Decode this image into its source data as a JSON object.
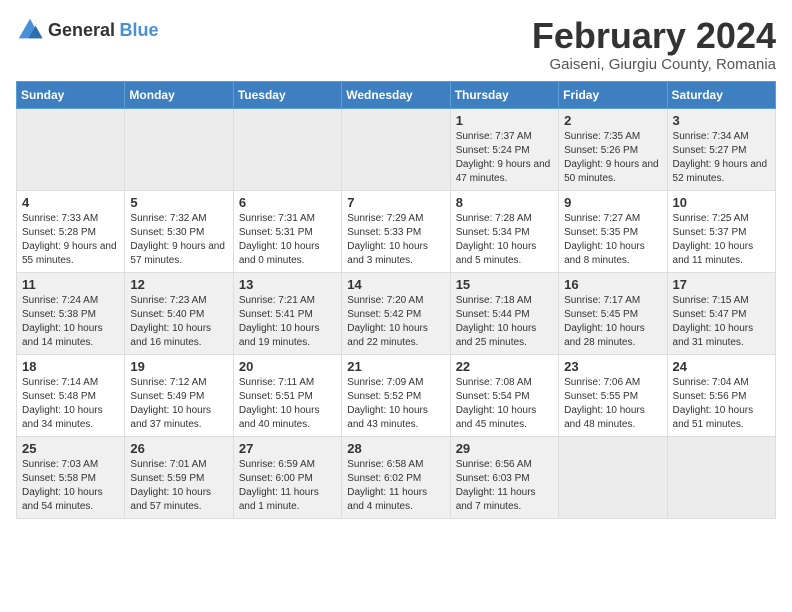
{
  "logo": {
    "general": "General",
    "blue": "Blue"
  },
  "header": {
    "month_year": "February 2024",
    "location": "Gaiseni, Giurgiu County, Romania"
  },
  "weekdays": [
    "Sunday",
    "Monday",
    "Tuesday",
    "Wednesday",
    "Thursday",
    "Friday",
    "Saturday"
  ],
  "weeks": [
    [
      {
        "day": "",
        "info": ""
      },
      {
        "day": "",
        "info": ""
      },
      {
        "day": "",
        "info": ""
      },
      {
        "day": "",
        "info": ""
      },
      {
        "day": "1",
        "info": "Sunrise: 7:37 AM\nSunset: 5:24 PM\nDaylight: 9 hours\nand 47 minutes."
      },
      {
        "day": "2",
        "info": "Sunrise: 7:35 AM\nSunset: 5:26 PM\nDaylight: 9 hours\nand 50 minutes."
      },
      {
        "day": "3",
        "info": "Sunrise: 7:34 AM\nSunset: 5:27 PM\nDaylight: 9 hours\nand 52 minutes."
      }
    ],
    [
      {
        "day": "4",
        "info": "Sunrise: 7:33 AM\nSunset: 5:28 PM\nDaylight: 9 hours\nand 55 minutes."
      },
      {
        "day": "5",
        "info": "Sunrise: 7:32 AM\nSunset: 5:30 PM\nDaylight: 9 hours\nand 57 minutes."
      },
      {
        "day": "6",
        "info": "Sunrise: 7:31 AM\nSunset: 5:31 PM\nDaylight: 10 hours\nand 0 minutes."
      },
      {
        "day": "7",
        "info": "Sunrise: 7:29 AM\nSunset: 5:33 PM\nDaylight: 10 hours\nand 3 minutes."
      },
      {
        "day": "8",
        "info": "Sunrise: 7:28 AM\nSunset: 5:34 PM\nDaylight: 10 hours\nand 5 minutes."
      },
      {
        "day": "9",
        "info": "Sunrise: 7:27 AM\nSunset: 5:35 PM\nDaylight: 10 hours\nand 8 minutes."
      },
      {
        "day": "10",
        "info": "Sunrise: 7:25 AM\nSunset: 5:37 PM\nDaylight: 10 hours\nand 11 minutes."
      }
    ],
    [
      {
        "day": "11",
        "info": "Sunrise: 7:24 AM\nSunset: 5:38 PM\nDaylight: 10 hours\nand 14 minutes."
      },
      {
        "day": "12",
        "info": "Sunrise: 7:23 AM\nSunset: 5:40 PM\nDaylight: 10 hours\nand 16 minutes."
      },
      {
        "day": "13",
        "info": "Sunrise: 7:21 AM\nSunset: 5:41 PM\nDaylight: 10 hours\nand 19 minutes."
      },
      {
        "day": "14",
        "info": "Sunrise: 7:20 AM\nSunset: 5:42 PM\nDaylight: 10 hours\nand 22 minutes."
      },
      {
        "day": "15",
        "info": "Sunrise: 7:18 AM\nSunset: 5:44 PM\nDaylight: 10 hours\nand 25 minutes."
      },
      {
        "day": "16",
        "info": "Sunrise: 7:17 AM\nSunset: 5:45 PM\nDaylight: 10 hours\nand 28 minutes."
      },
      {
        "day": "17",
        "info": "Sunrise: 7:15 AM\nSunset: 5:47 PM\nDaylight: 10 hours\nand 31 minutes."
      }
    ],
    [
      {
        "day": "18",
        "info": "Sunrise: 7:14 AM\nSunset: 5:48 PM\nDaylight: 10 hours\nand 34 minutes."
      },
      {
        "day": "19",
        "info": "Sunrise: 7:12 AM\nSunset: 5:49 PM\nDaylight: 10 hours\nand 37 minutes."
      },
      {
        "day": "20",
        "info": "Sunrise: 7:11 AM\nSunset: 5:51 PM\nDaylight: 10 hours\nand 40 minutes."
      },
      {
        "day": "21",
        "info": "Sunrise: 7:09 AM\nSunset: 5:52 PM\nDaylight: 10 hours\nand 43 minutes."
      },
      {
        "day": "22",
        "info": "Sunrise: 7:08 AM\nSunset: 5:54 PM\nDaylight: 10 hours\nand 45 minutes."
      },
      {
        "day": "23",
        "info": "Sunrise: 7:06 AM\nSunset: 5:55 PM\nDaylight: 10 hours\nand 48 minutes."
      },
      {
        "day": "24",
        "info": "Sunrise: 7:04 AM\nSunset: 5:56 PM\nDaylight: 10 hours\nand 51 minutes."
      }
    ],
    [
      {
        "day": "25",
        "info": "Sunrise: 7:03 AM\nSunset: 5:58 PM\nDaylight: 10 hours\nand 54 minutes."
      },
      {
        "day": "26",
        "info": "Sunrise: 7:01 AM\nSunset: 5:59 PM\nDaylight: 10 hours\nand 57 minutes."
      },
      {
        "day": "27",
        "info": "Sunrise: 6:59 AM\nSunset: 6:00 PM\nDaylight: 11 hours\nand 1 minute."
      },
      {
        "day": "28",
        "info": "Sunrise: 6:58 AM\nSunset: 6:02 PM\nDaylight: 11 hours\nand 4 minutes."
      },
      {
        "day": "29",
        "info": "Sunrise: 6:56 AM\nSunset: 6:03 PM\nDaylight: 11 hours\nand 7 minutes."
      },
      {
        "day": "",
        "info": ""
      },
      {
        "day": "",
        "info": ""
      }
    ]
  ]
}
